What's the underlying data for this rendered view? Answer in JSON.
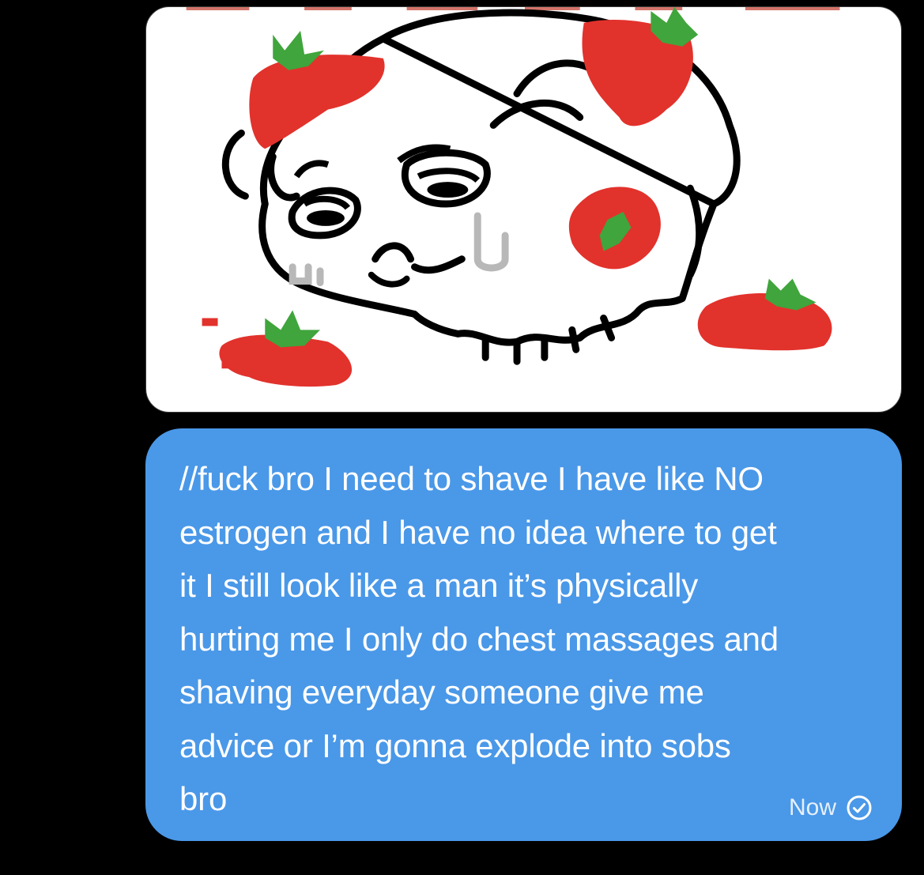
{
  "conversation": {
    "image_message": {
      "alt_icon": "skull-strawberry-drawing"
    },
    "text_message": {
      "text": "//fuck bro I need to shave I have like NO\nestrogen and I have no idea where to get\nit I still look like a man it’s physically\nhurting me I only do chest massages and\nshaving everyday someone give me\nadvice or I’m gonna explode into sobs\nbro",
      "timestamp": "Now",
      "status_icon": "sent-check-icon"
    }
  },
  "colors": {
    "background": "#000000",
    "bubble_blue": "#4a98e8",
    "image_bubble_bg": "#ffffff",
    "strawberry_red": "#e2322c",
    "leaf_green": "#3fa53c"
  }
}
